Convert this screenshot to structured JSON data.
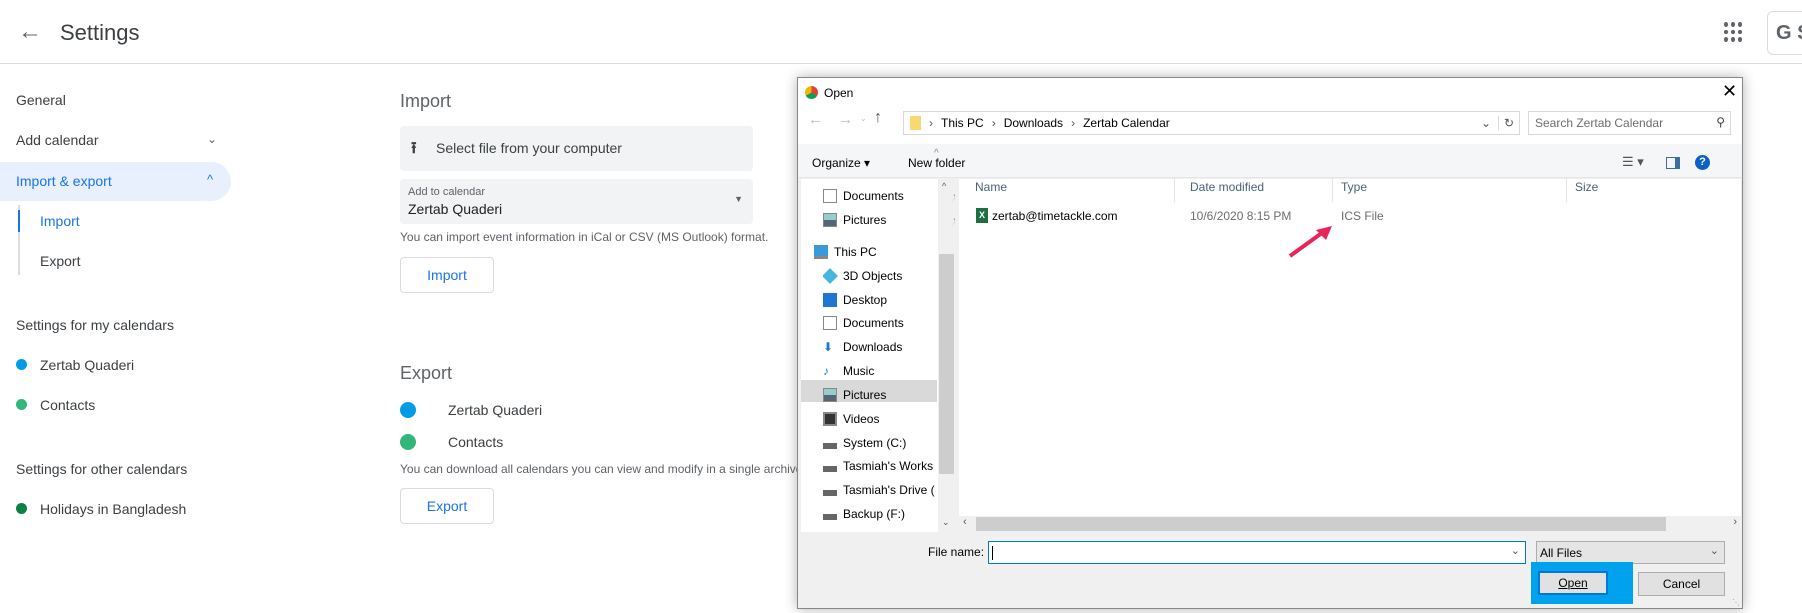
{
  "header": {
    "title": "Settings",
    "account_button_text": "G S"
  },
  "sidebar": {
    "items": [
      {
        "label": "General"
      },
      {
        "label": "Add calendar"
      },
      {
        "label": "Import & export"
      }
    ],
    "subitems": [
      {
        "label": "Import"
      },
      {
        "label": "Export"
      }
    ],
    "my_calendars_heading": "Settings for my calendars",
    "my_calendars": [
      {
        "label": "Zertab Quaderi",
        "color": "#039be5"
      },
      {
        "label": "Contacts",
        "color": "#33b679"
      }
    ],
    "other_calendars_heading": "Settings for other calendars",
    "other_calendars": [
      {
        "label": "Holidays in Bangladesh",
        "color": "#0b8043"
      }
    ]
  },
  "import": {
    "heading": "Import",
    "select_file": "Select file from your computer",
    "add_to_label": "Add to calendar",
    "add_to_value": "Zertab Quaderi",
    "help": "You can import event information in iCal or CSV (MS Outlook) format.",
    "button": "Import"
  },
  "export": {
    "heading": "Export",
    "calendars": [
      {
        "label": "Zertab Quaderi",
        "color": "#039be5"
      },
      {
        "label": "Contacts",
        "color": "#33b679"
      }
    ],
    "help": "You can download all calendars you can view and modify in a single archive",
    "button": "Export"
  },
  "dialog": {
    "title": "Open",
    "breadcrumb": [
      "This PC",
      "Downloads",
      "Zertab Calendar"
    ],
    "search_placeholder": "Search Zertab Calendar",
    "organize": "Organize ▾",
    "new_folder": "New folder",
    "nav": [
      {
        "label": "Documents",
        "icon": "documents-icon"
      },
      {
        "label": "Pictures",
        "icon": "pictures-icon"
      },
      {
        "label": "This PC",
        "icon": "computer-icon"
      },
      {
        "label": "3D Objects",
        "icon": "3d-objects-icon"
      },
      {
        "label": "Desktop",
        "icon": "desktop-icon"
      },
      {
        "label": "Documents",
        "icon": "documents-icon"
      },
      {
        "label": "Downloads",
        "icon": "downloads-icon",
        "selected": true
      },
      {
        "label": "Music",
        "icon": "music-icon"
      },
      {
        "label": "Pictures",
        "icon": "pictures-icon"
      },
      {
        "label": "Videos",
        "icon": "videos-icon"
      },
      {
        "label": "System (C:)",
        "icon": "drive-icon"
      },
      {
        "label": "Tasmiah's Works",
        "icon": "drive-icon"
      },
      {
        "label": "Tasmiah's Drive (",
        "icon": "drive-icon"
      },
      {
        "label": "Backup (F:)",
        "icon": "drive-icon"
      }
    ],
    "columns": [
      "Name",
      "Date modified",
      "Type",
      "Size"
    ],
    "files": [
      {
        "name": "zertab@timetackle.com",
        "date": "10/6/2020 8:15 PM",
        "type": "ICS File",
        "size": ""
      }
    ],
    "file_name_label": "File name:",
    "file_name_value": "",
    "filter": "All Files",
    "open_button": "Open",
    "cancel_button": "Cancel",
    "highlight_color": "#00a2ed",
    "arrow_color": "#e8245a"
  }
}
